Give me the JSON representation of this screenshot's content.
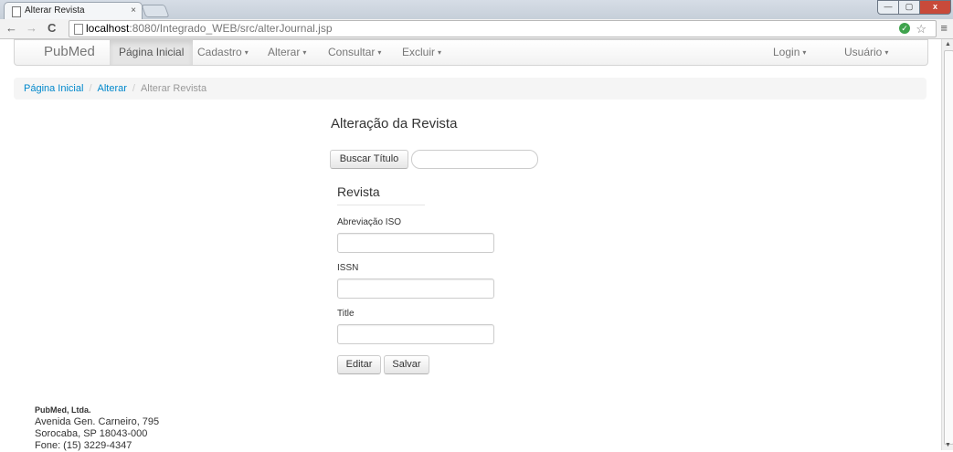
{
  "browser": {
    "tab_title": "Alterar Revista",
    "tab_close": "×",
    "url_host": "localhost",
    "url_path": ":8080/Integrado_WEB/src/alterJournal.jsp",
    "nav_back": "←",
    "nav_forward": "→",
    "nav_reload": "C",
    "window_min": "—",
    "window_max": "▢",
    "window_close": "x",
    "star": "☆",
    "menu": "≡",
    "shield": "✓"
  },
  "navbar": {
    "brand": "PubMed",
    "items": [
      {
        "label": "Página Inicial",
        "caret": ""
      },
      {
        "label": "Cadastro",
        "caret": "▾"
      },
      {
        "label": "Alterar",
        "caret": "▾"
      },
      {
        "label": "Consultar",
        "caret": "▾"
      },
      {
        "label": "Excluir",
        "caret": "▾"
      }
    ],
    "right_items": [
      {
        "label": "Login",
        "caret": "▾"
      },
      {
        "label": "Usuário",
        "caret": "▾"
      }
    ]
  },
  "breadcrumb": {
    "home": "Página Inicial",
    "section": "Alterar",
    "separator": "/",
    "current": "Alterar Revista"
  },
  "main": {
    "title": "Alteração da Revista",
    "search_button": "Buscar Título",
    "search_value": "",
    "legend": "Revista",
    "fields": [
      {
        "label": "Abreviação ISO",
        "value": ""
      },
      {
        "label": "ISSN",
        "value": ""
      },
      {
        "label": "Title",
        "value": ""
      }
    ],
    "edit_button": "Editar",
    "save_button": "Salvar"
  },
  "footer": {
    "company": "PubMed, Ltda.",
    "address": "Avenida Gen. Carneiro, 795",
    "city": "Sorocaba, SP 18043-000",
    "phone": "Fone: (15) 3229-4347"
  }
}
